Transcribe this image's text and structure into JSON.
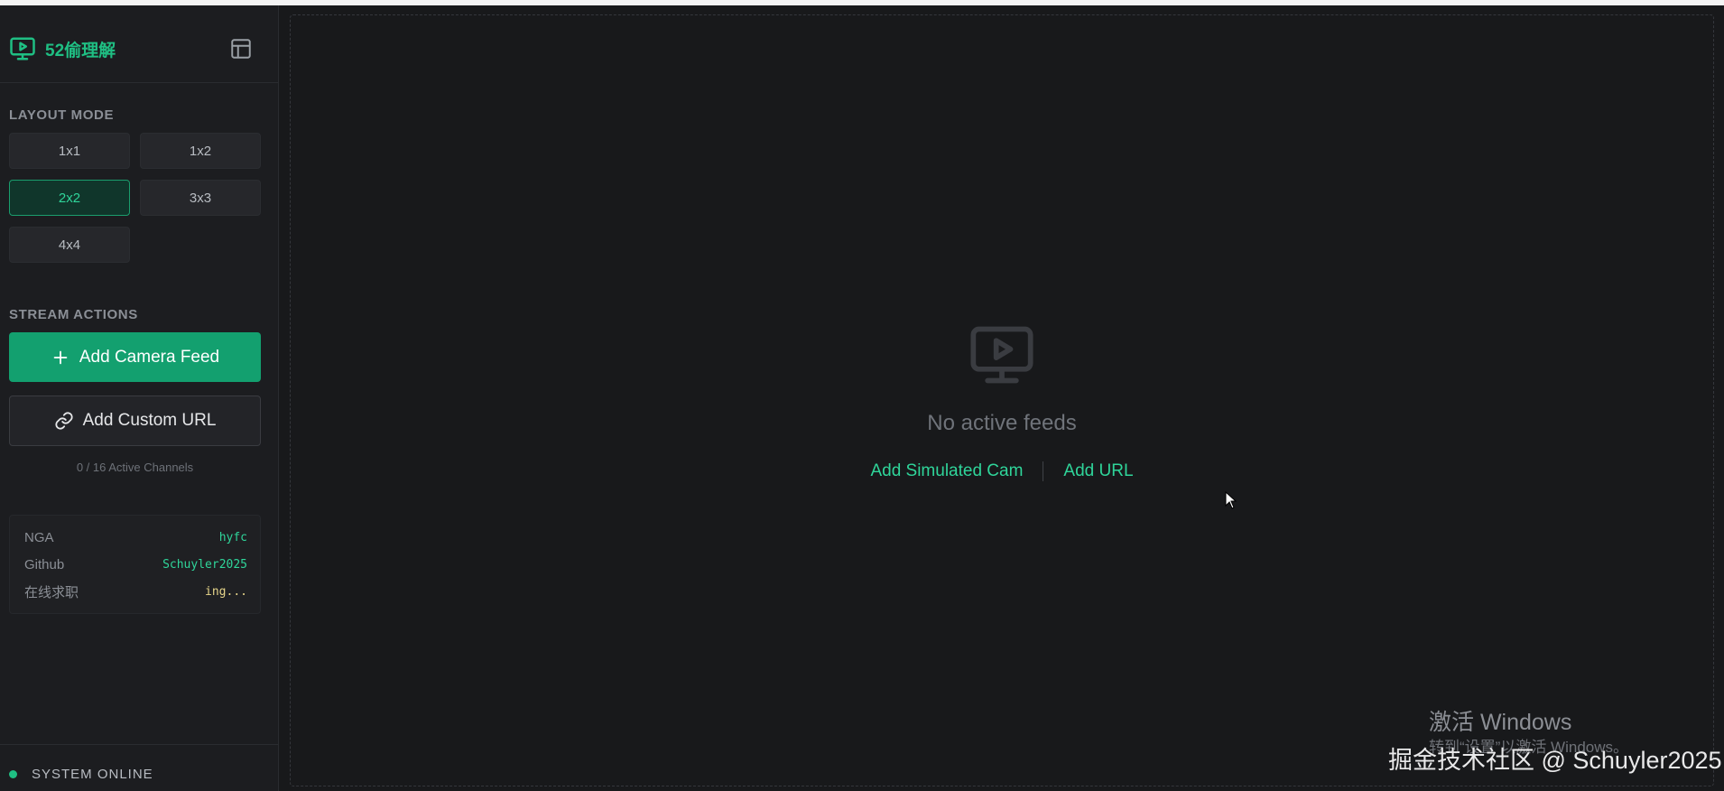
{
  "brand": {
    "title": "52偷理解"
  },
  "sidebar": {
    "layout_label": "LAYOUT MODE",
    "layouts": [
      {
        "label": "1x1",
        "active": false
      },
      {
        "label": "1x2",
        "active": false
      },
      {
        "label": "2x2",
        "active": true
      },
      {
        "label": "3x3",
        "active": false
      },
      {
        "label": "4x4",
        "active": false
      }
    ],
    "actions_label": "STREAM ACTIONS",
    "add_camera_label": "Add Camera Feed",
    "add_url_label": "Add Custom URL",
    "active_channels": "0 / 16 Active Channels",
    "info": [
      {
        "key": "NGA",
        "value": "hyfc"
      },
      {
        "key": "Github",
        "value": "Schuyler2025"
      },
      {
        "key": "在线求职",
        "value": "ing..."
      }
    ],
    "status": "SYSTEM ONLINE"
  },
  "main": {
    "empty_title": "No active feeds",
    "add_simulated": "Add Simulated Cam",
    "add_url": "Add URL"
  },
  "overlay": {
    "windows_title": "激活 Windows",
    "windows_sub": "转到“设置”以激活 Windows。",
    "credit": "掘金技术社区 @ Schuyler2025"
  },
  "colors": {
    "accent": "#1fbf83",
    "primary_button": "#13a06f",
    "background": "#18191b",
    "sidebar": "#1c1d20"
  },
  "icons": [
    "monitor-play-icon",
    "layout-panel-icon",
    "plus-icon",
    "link-icon",
    "status-dot"
  ]
}
